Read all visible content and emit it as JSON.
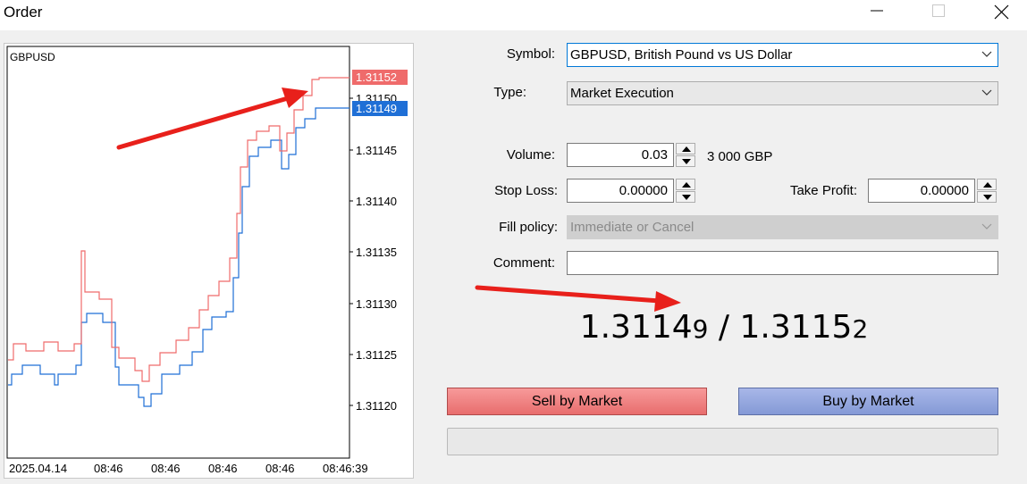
{
  "window": {
    "title": "Order",
    "controls": [
      "minimize",
      "maximize",
      "close"
    ]
  },
  "chart": {
    "symbol": "GBPUSD",
    "ask_tag": "1.31152",
    "bid_tag": "1.31149",
    "ask_color": "#ef6b6b",
    "bid_color": "#1f6fd6",
    "y_ticks": [
      "1.31150",
      "1.31145",
      "1.31140",
      "1.31135",
      "1.31130",
      "1.31125",
      "1.31120"
    ],
    "x_ticks": [
      "2025.04.14",
      "08:46",
      "08:46",
      "08:46",
      "08:46",
      "08:46:39"
    ]
  },
  "form": {
    "symbol_label": "Symbol:",
    "symbol_value": "GBPUSD, British Pound vs US Dollar",
    "type_label": "Type:",
    "type_value": "Market Execution",
    "volume_label": "Volume:",
    "volume_value": "0.03",
    "volume_info": "3 000 GBP",
    "stop_loss_label": "Stop Loss:",
    "stop_loss_value": "0.00000",
    "take_profit_label": "Take Profit:",
    "take_profit_value": "0.00000",
    "fill_policy_label": "Fill policy:",
    "fill_policy_value": "Immediate or Cancel",
    "comment_label": "Comment:",
    "comment_value": ""
  },
  "prices": {
    "bid_main": "1.3114",
    "bid_small": "9",
    "separator": " / ",
    "ask_main": "1.3115",
    "ask_small": "2"
  },
  "buttons": {
    "sell_label": "Sell by Market",
    "buy_label": "Buy by Market"
  },
  "annotation_color": "#e8201b"
}
